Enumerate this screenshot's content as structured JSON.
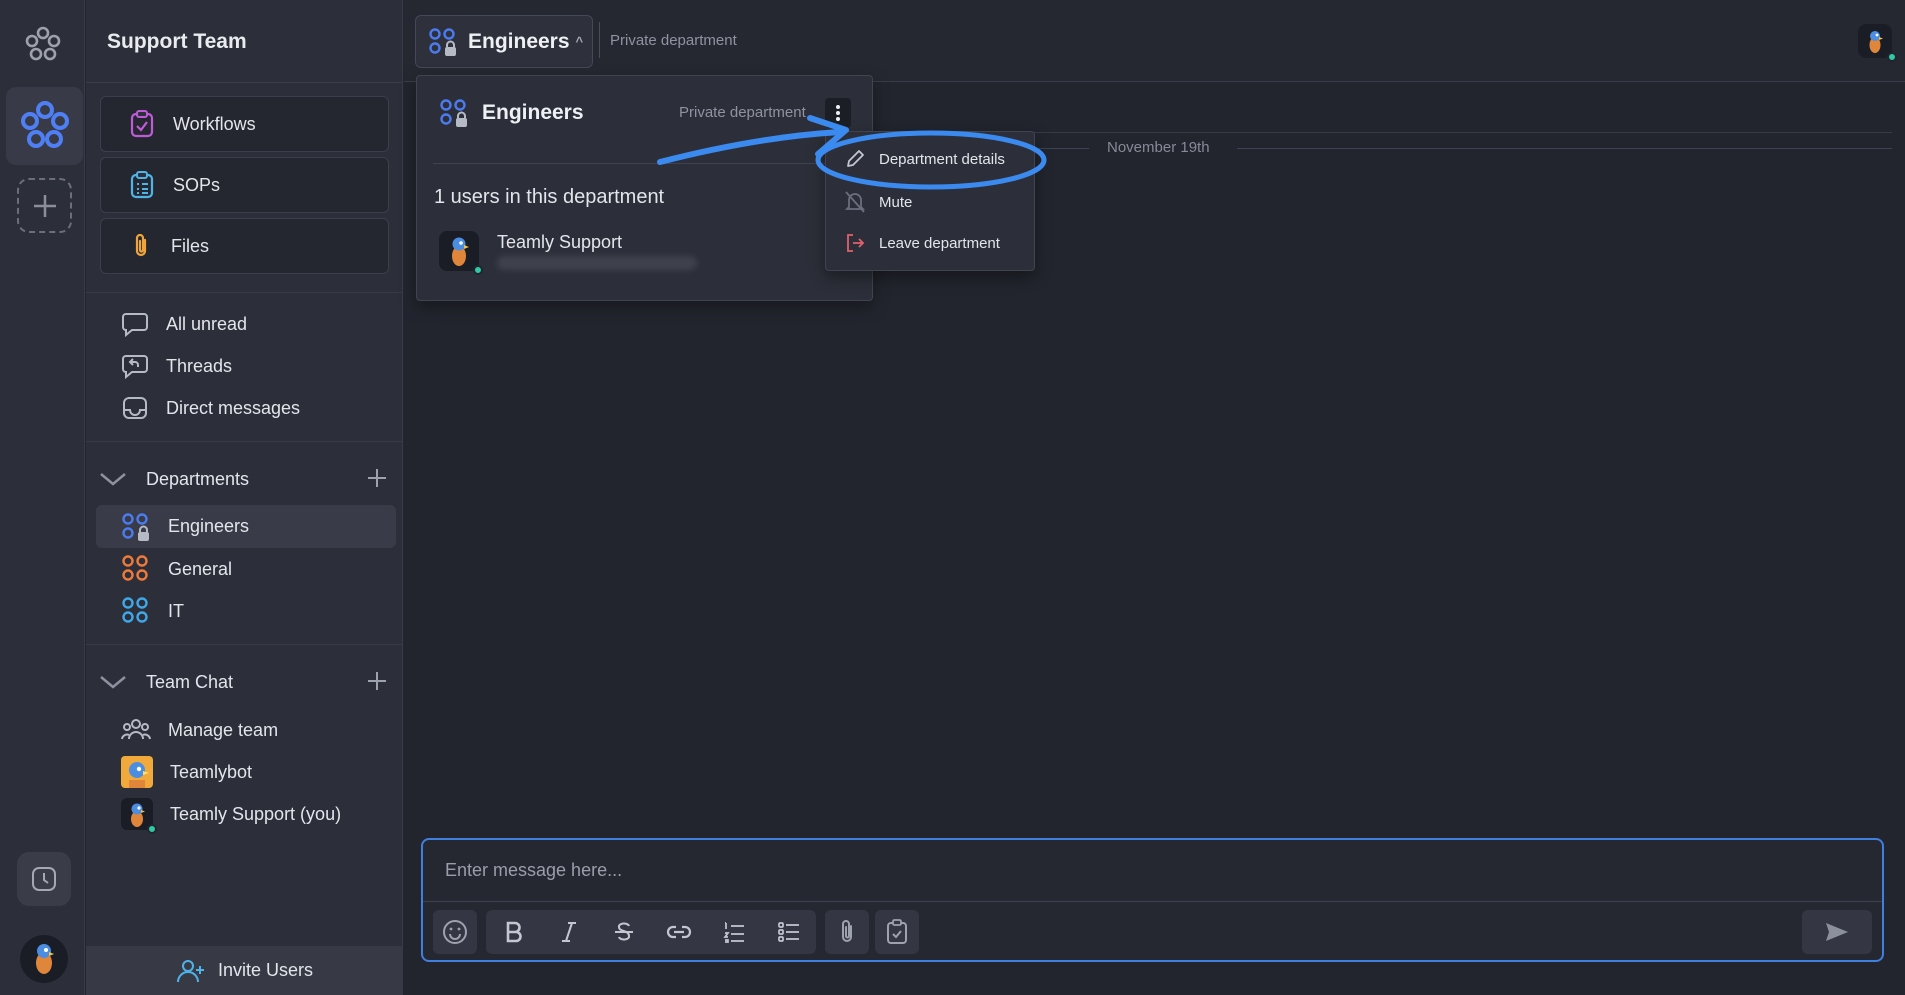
{
  "sidebar": {
    "team_name": "Support Team",
    "main_buttons": [
      {
        "label": "Workflows",
        "icon": "clipboard-check-icon",
        "color": "#c05bd8"
      },
      {
        "label": "SOPs",
        "icon": "list-clipboard-icon",
        "color": "#4fb3e8"
      },
      {
        "label": "Files",
        "icon": "paperclip-icon",
        "color": "#f0a53a"
      }
    ],
    "nav": [
      {
        "label": "All unread",
        "icon": "chat-bubble-icon"
      },
      {
        "label": "Threads",
        "icon": "threads-icon"
      },
      {
        "label": "Direct messages",
        "icon": "inbox-icon"
      }
    ],
    "departments": {
      "title": "Departments",
      "items": [
        {
          "label": "Engineers",
          "icon": "private-department-icon",
          "color": "#4c7bf0"
        },
        {
          "label": "General",
          "icon": "department-icon",
          "color": "#ef7b3a"
        },
        {
          "label": "IT",
          "icon": "department-icon",
          "color": "#3fa8e8"
        }
      ]
    },
    "team_chat": {
      "title": "Team Chat",
      "items": [
        {
          "label": "Manage team",
          "icon": "team-icon"
        },
        {
          "label": "Teamlybot",
          "icon": "bot-avatar"
        },
        {
          "label": "Teamly Support (you)",
          "icon": "user-avatar"
        }
      ]
    },
    "invite_label": "Invite Users"
  },
  "header": {
    "department": "Engineers",
    "subtitle": "Private department"
  },
  "popover": {
    "title": "Engineers",
    "subtitle": "Private department",
    "user_count_text": "1 users in this department",
    "user_name": "Teamly Support"
  },
  "context_menu": {
    "items": [
      {
        "label": "Department details",
        "icon": "pencil-icon"
      },
      {
        "label": "Mute",
        "icon": "bell-off-icon"
      },
      {
        "label": "Leave department",
        "icon": "logout-icon",
        "color": "#e0606d"
      }
    ],
    "highlight_color": "#3b8aef"
  },
  "date_divider": "November 19th",
  "composer": {
    "placeholder": "Enter message here..."
  },
  "colors": {
    "accent": "#3e7fe0",
    "online": "#2fc9a5"
  }
}
